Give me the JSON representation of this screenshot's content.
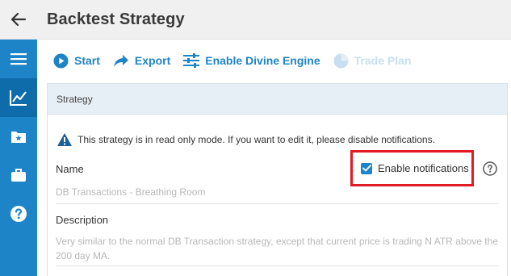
{
  "header": {
    "title": "Backtest Strategy",
    "back_icon": "arrow-left-icon"
  },
  "sidebar": {
    "items": [
      {
        "id": "menu",
        "icon": "hamburger-icon"
      },
      {
        "id": "charts",
        "icon": "chart-line-icon",
        "active": true
      },
      {
        "id": "starred",
        "icon": "folder-star-icon"
      },
      {
        "id": "portfolio",
        "icon": "briefcase-icon"
      },
      {
        "id": "help",
        "icon": "question-circle-icon"
      }
    ]
  },
  "toolbar": {
    "start_label": "Start",
    "export_label": "Export",
    "divine_label": "Enable Divine Engine",
    "tradeplan_label": "Trade Plan"
  },
  "panel": {
    "title": "Strategy",
    "warning": "This strategy is in read only mode. If you want to edit it, please disable notifications.",
    "name_label": "Name",
    "name_value": "DB Transactions - Breathing Room",
    "notifications_label": "Enable notifications",
    "notifications_checked": true,
    "description_label": "Description",
    "description_value": "Very similar to the normal DB Transaction strategy, except that current price is trading N ATR above the 200 day MA."
  },
  "colors": {
    "accent": "#1e84c8",
    "sidebar_active": "#0f6cab",
    "highlight": "#e01b24",
    "disabled": "#c7dff0"
  }
}
